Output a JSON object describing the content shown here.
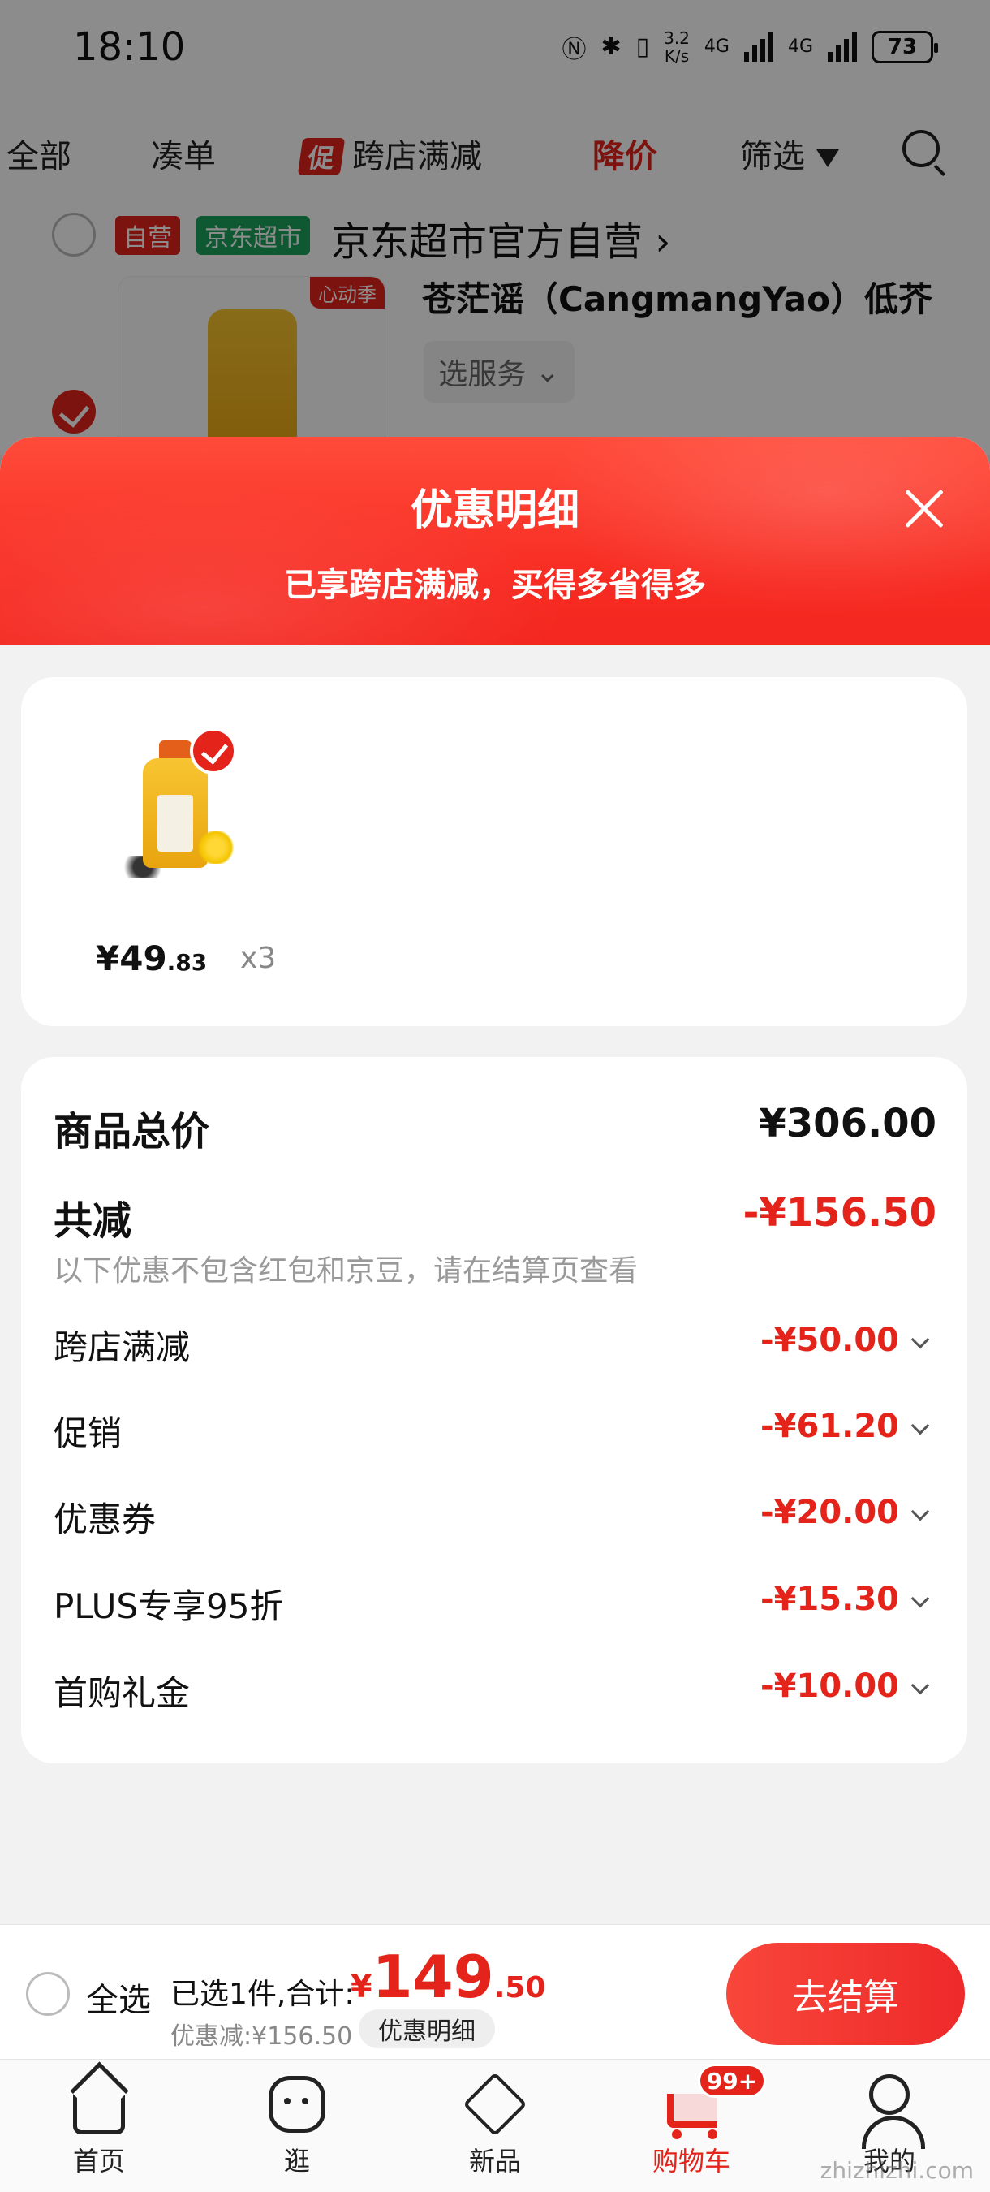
{
  "status_bar": {
    "time": "18:10",
    "network_speed_value": "3.2",
    "network_speed_unit": "K/s",
    "signal1": "4G",
    "signal2": "4G",
    "battery": "73"
  },
  "filter_tabs": {
    "all": "全部",
    "bundle": "凑单",
    "promo_badge": "促",
    "cross_store": "跨店满减",
    "price_drop": "降价",
    "filter": "筛选"
  },
  "store": {
    "tag_self": "自营",
    "tag_market": "京东超市",
    "name": "京东超市官方自营",
    "product_badge": "心动季",
    "product_title": "苍茫谣（CangmangYao）低芥",
    "service_button": "选服务"
  },
  "sheet": {
    "title": "优惠明细",
    "subtitle": "已享跨店满减，买得多省得多",
    "item": {
      "price_main": "¥49",
      "price_cents": ".83",
      "quantity": "x3"
    },
    "summary": {
      "total_label": "商品总价",
      "total_value": "¥306.00",
      "discount_label": "共减",
      "discount_value": "-¥156.50",
      "discount_note": "以下优惠不包含红包和京豆，请在结算页查看"
    },
    "discounts": [
      {
        "label": "跨店满减",
        "value": "-¥50.00"
      },
      {
        "label": "促销",
        "value": "-¥61.20"
      },
      {
        "label": "优惠券",
        "value": "-¥20.00"
      },
      {
        "label": "PLUS专享95折",
        "value": "-¥15.30"
      },
      {
        "label": "首购礼金",
        "value": "-¥10.00"
      }
    ]
  },
  "bottom_bar": {
    "select_all": "全选",
    "selected_text": "已选1件,合计:",
    "currency": "¥",
    "total_main": "149",
    "total_decimal": ".50",
    "discount_text": "优惠减:¥156.50",
    "detail_pill": "优惠明细",
    "checkout": "去结算"
  },
  "nav": {
    "items": [
      {
        "label": "首页",
        "icon": "home-icon"
      },
      {
        "label": "逛",
        "icon": "discover-icon"
      },
      {
        "label": "新品",
        "icon": "new-products-icon"
      },
      {
        "label": "购物车",
        "icon": "cart-icon"
      },
      {
        "label": "我的",
        "icon": "profile-icon"
      }
    ],
    "cart_badge": "99+",
    "active_color": "#e4241a"
  },
  "watermark": "zhizhizhi.com",
  "colors": {
    "accent": "#e4241a",
    "market_tag": "#1aa35b"
  }
}
